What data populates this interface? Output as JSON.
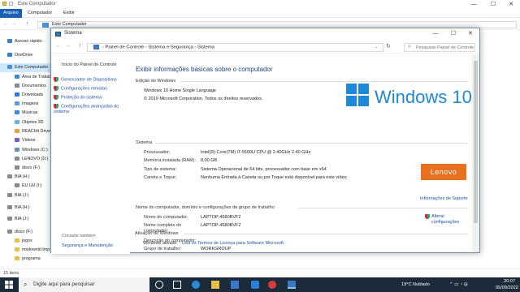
{
  "explorer": {
    "title": "Este Computador",
    "ribbon_tabs": [
      "Arquivo",
      "Computador",
      "Exibir"
    ],
    "address": "Este Computador",
    "sidebar": [
      {
        "label": "Acesso rápido",
        "color": "#3a7fd5"
      },
      {
        "label": "OneDrive",
        "color": "#2f7de1"
      },
      {
        "label": "Este Computador",
        "color": "#4a90d9",
        "selected": true
      },
      {
        "label": "Área de Trabal",
        "color": "#3b8ad8"
      },
      {
        "label": "Documentos",
        "color": "#7a8a99"
      },
      {
        "label": "Downloads",
        "color": "#2b78d8"
      },
      {
        "label": "Imagens",
        "color": "#5a9ad8"
      },
      {
        "label": "Músicas",
        "color": "#3b8ad8"
      },
      {
        "label": "Objetos 3D",
        "color": "#6ab0e0"
      },
      {
        "label": "REACHit Drive",
        "color": "#e6a23c"
      },
      {
        "label": "Vídeos",
        "color": "#7a5fc0"
      },
      {
        "label": "Windows (C:)",
        "color": "#6b8fb5"
      },
      {
        "label": "LENOVO (D:)",
        "color": "#8a8a8a"
      },
      {
        "label": "disco (F:)",
        "color": "#8a8a8a"
      },
      {
        "label": "BIA (H:)",
        "color": "#8a8a8a"
      },
      {
        "label": "EU UU (I:)",
        "color": "#8a8a8a"
      },
      {
        "label": "BIA (J:)",
        "color": "#8a8a8a"
      },
      {
        "label": "BIA (H:)",
        "color": "#8a8a8a"
      },
      {
        "label": "BIA (J:)",
        "color": "#8a8a8a"
      },
      {
        "label": "disco (F:)",
        "color": "#8a8a8a"
      },
      {
        "label": "jogos",
        "color": "#e6c04a"
      },
      {
        "label": "msdownld.tmp",
        "color": "#e6c04a"
      },
      {
        "label": "programa",
        "color": "#e6c04a"
      }
    ],
    "status": "15 itens"
  },
  "window": {
    "title": "Sistema",
    "breadcrumb": [
      "Painel de Controle",
      "Sistema e Segurança",
      "Sistema"
    ],
    "search_placeholder": "Pesquisar Painel de Controle",
    "left_links": {
      "home": "Início do Painel de Controle",
      "items": [
        "Gerenciador de Dispositivos",
        "Configurações remotas",
        "Proteção do sistema",
        "Configurações avançadas do sistema"
      ],
      "see_also": "Consulte também",
      "security": "Segurança e Manutenção"
    },
    "heading": "Exibir informações básicas sobre o computador",
    "edition_section": "Edição do Windows",
    "edition": "Windows 10 Home Single Language",
    "copyright": "© 2019 Microsoft Corporation. Todos os direitos reservados.",
    "logo_text": "Windows 10",
    "system_section": "Sistema",
    "system_rows": [
      {
        "label": "Processador:",
        "value": "Intel(R) Core(TM) i7-5500U CPU @ 2.40GHz   2.40 GHz"
      },
      {
        "label": "Memória instalada (RAM):",
        "value": "8,00 GB"
      },
      {
        "label": "Tipo de sistema:",
        "value": "Sistema Operacional de 64 bits, processador com base em x64"
      },
      {
        "label": "Caneta e Toque:",
        "value": "Nenhuma Entrada à Caneta ou por Toque está disponível para este vídeo"
      }
    ],
    "oem_logo": "Lenovo",
    "support_link": "Informações de Suporte",
    "name_section": "Nome do computador, domínio e configurações de grupo de trabalho",
    "name_rows": [
      {
        "label": "Nome do computador:",
        "value": "LAPTOP-4680BVF2"
      },
      {
        "label": "Nome completo do computador:",
        "value": "LAPTOP-4680BVF2"
      },
      {
        "label": "Descrição do computador:",
        "value": ""
      },
      {
        "label": "Grupo de trabalho:",
        "value": "WORKGROUP"
      }
    ],
    "change_link": "Alterar configurações",
    "activation_section": "Ativação do Windows",
    "activation_label": "Windows ativado",
    "activation_link": "Leia os Termos de Licença para Software Microsoft"
  },
  "taskbar": {
    "search_placeholder": "Digite aqui para pesquisar",
    "weather": "19°C  Nublado",
    "time": "20:07",
    "date": "05/09/2022"
  }
}
